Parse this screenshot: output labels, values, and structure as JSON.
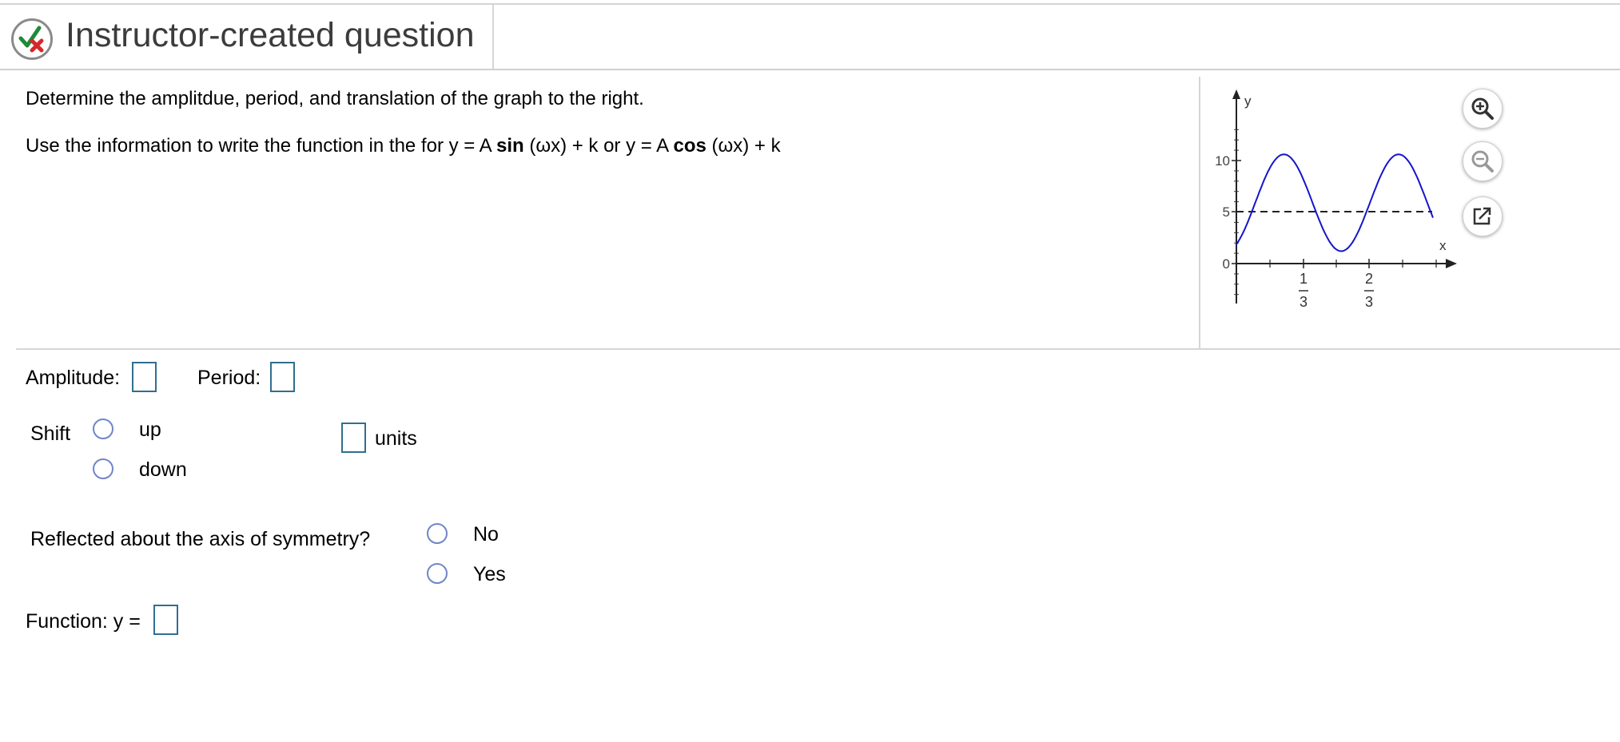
{
  "header": {
    "title": "Instructor-created question"
  },
  "question": {
    "line1": "Determine the amplitdue, period, and translation of the graph to the right.",
    "line2": {
      "part1": "Use the information to write the function in the for y = A ",
      "sin": "sin",
      "part2": " (ωx) + k or y = A ",
      "cos": "cos",
      "part3": " (ωx) + k"
    }
  },
  "graph": {
    "y_axis_label": "y",
    "x_axis_label": "x",
    "y_ticks": [
      "10",
      "5",
      "0"
    ],
    "x_tick_numerators": [
      "1",
      "2"
    ],
    "x_tick_denominators": [
      "3",
      "3"
    ]
  },
  "answers": {
    "amplitude_label": "Amplitude:",
    "period_label": "Period:",
    "shift_label": "Shift",
    "shift_up": "up",
    "shift_down": "down",
    "units_label": "units",
    "reflected_label": "Reflected about the axis of symmetry?",
    "reflect_no": "No",
    "reflect_yes": "Yes",
    "function_label": "Function: y ="
  },
  "tools": {
    "zoom_in": "zoom-in-icon",
    "zoom_out": "zoom-out-icon",
    "popout": "popout-icon"
  },
  "colors": {
    "curve": "#1515cc",
    "input_border": "#2f6f8f",
    "radio_border": "#6f86c7",
    "check": "#1e8a3a",
    "cross": "#d62828"
  }
}
